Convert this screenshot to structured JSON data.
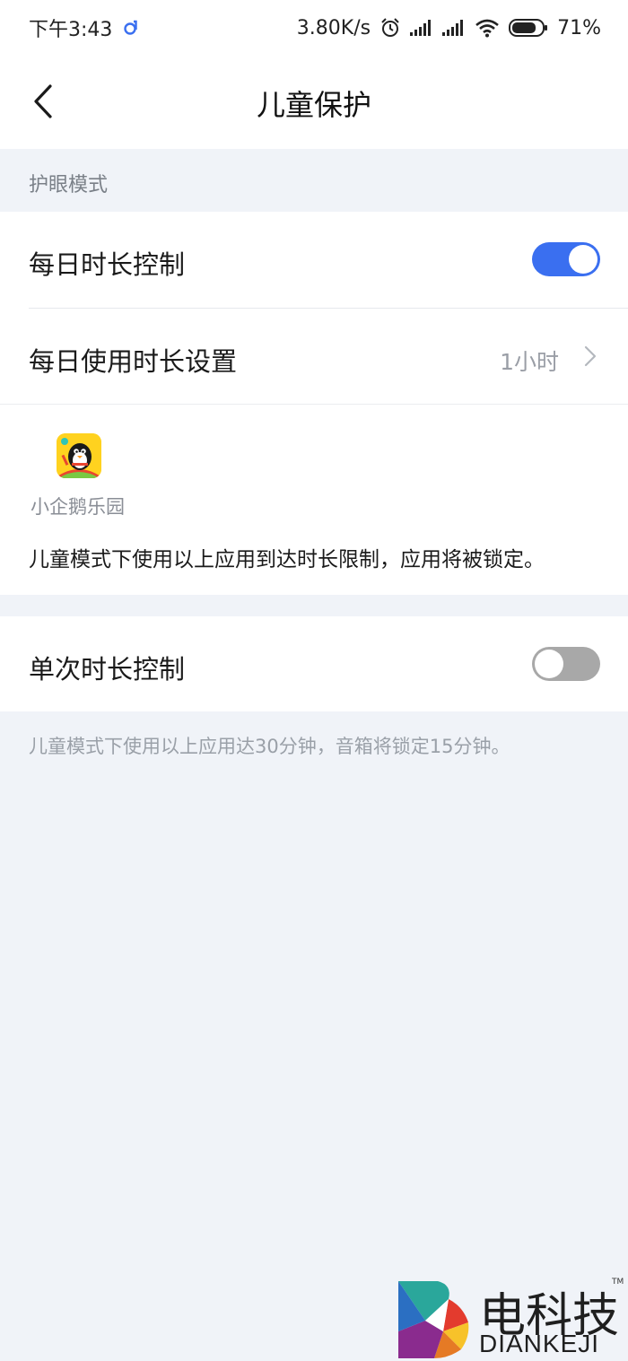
{
  "status_bar": {
    "time": "下午3:43",
    "net_speed": "3.80K/s",
    "battery": "71%"
  },
  "header": {
    "title": "儿童保护"
  },
  "section": {
    "label": "护眼模式"
  },
  "daily_control": {
    "label": "每日时长控制",
    "enabled": true
  },
  "usage_setting": {
    "label": "每日使用时长设置",
    "value": "1小时"
  },
  "app": {
    "name": "小企鹅乐园"
  },
  "card_note": "儿童模式下使用以上应用到达时长限制，应用将被锁定。",
  "single_control": {
    "label": "单次时长控制",
    "enabled": false
  },
  "footnote": "儿童模式下使用以上应用达30分钟，音箱将锁定15分钟。",
  "watermark": {
    "cn": "电科技",
    "en": "DIANKEJI",
    "tm": "TM"
  },
  "colors": {
    "accent": "#3a6ff0",
    "background": "#f0f3f8",
    "toggle_off": "#a8a8a8"
  }
}
